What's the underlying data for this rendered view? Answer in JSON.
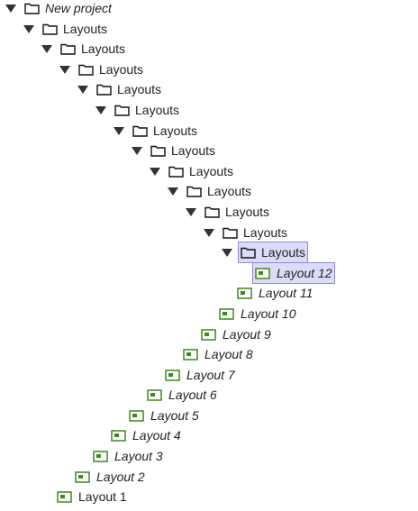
{
  "tree": {
    "root": {
      "label": "New project"
    },
    "folders": [
      {
        "label": "Layouts"
      },
      {
        "label": "Layouts"
      },
      {
        "label": "Layouts"
      },
      {
        "label": "Layouts"
      },
      {
        "label": "Layouts"
      },
      {
        "label": "Layouts"
      },
      {
        "label": "Layouts"
      },
      {
        "label": "Layouts"
      },
      {
        "label": "Layouts"
      },
      {
        "label": "Layouts"
      },
      {
        "label": "Layouts"
      },
      {
        "label": "Layouts",
        "selected": true
      }
    ],
    "layouts": [
      {
        "label": "Layout 12",
        "selected": true
      },
      {
        "label": "Layout 11"
      },
      {
        "label": "Layout 10"
      },
      {
        "label": "Layout 9"
      },
      {
        "label": "Layout 8"
      },
      {
        "label": "Layout 7"
      },
      {
        "label": "Layout 6"
      },
      {
        "label": "Layout 5"
      },
      {
        "label": "Layout 4"
      },
      {
        "label": "Layout 3"
      },
      {
        "label": "Layout 2"
      },
      {
        "label": "Layout 1",
        "italic": false
      }
    ]
  },
  "colors": {
    "layout_icon": "#3a8a1e",
    "selection_bg": "#dcdcfa",
    "selection_border": "#8a8ae0"
  },
  "icons": {
    "folder": "folder-icon",
    "layout": "layout-icon",
    "toggle": "triangle-down-icon"
  }
}
